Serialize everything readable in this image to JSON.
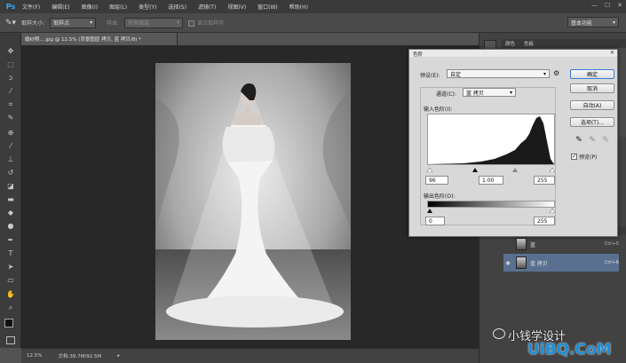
{
  "app": {
    "logo": "Ps"
  },
  "menu": [
    "文件(F)",
    "编辑(E)",
    "图像(I)",
    "图层(L)",
    "类型(Y)",
    "选择(S)",
    "滤镜(T)",
    "视图(V)",
    "窗口(W)",
    "帮助(H)"
  ],
  "window_controls": [
    "—",
    "☐",
    "✕"
  ],
  "options": {
    "sample_size_label": "取样大小:",
    "sample_size_value": "取样点",
    "sample_label": "样本:",
    "sample_value": "所有图层",
    "show_ring_label": "显示取样环",
    "workspace": "基本功能"
  },
  "document": {
    "tab_title": "婚纱照....jpg @ 12.5% (背景图层 拷贝, 蓝 拷贝/8) *",
    "zoom": "12.5%",
    "doc_size": "文档:39.7M/92.5M"
  },
  "panels": {
    "tabs": [
      "颜色",
      "色板"
    ],
    "layers": [
      {
        "name": "蓝",
        "shortcut": "Ctrl+5"
      },
      {
        "name": "蓝 拷贝",
        "shortcut": "Ctrl+6"
      }
    ]
  },
  "watermark": {
    "line1": "小钱学设计",
    "line2": "UiBQ.CoM"
  },
  "levels": {
    "title": "色阶",
    "preset_label": "预设(E):",
    "preset_value": "自定",
    "channel_label": "通道(C):",
    "channel_value": "蓝 拷贝",
    "input_label": "输入色阶(I):",
    "input_black": "96",
    "input_gamma": "1.00",
    "input_white": "255",
    "output_label": "输出色阶(O):",
    "output_black": "0",
    "output_white": "255",
    "buttons": {
      "ok": "确定",
      "cancel": "取消",
      "auto": "自动(A)",
      "options": "选项(T)..."
    },
    "preview_label": "预览(P)",
    "preview_checked": true,
    "close": "✕"
  },
  "tools": [
    "move-icon",
    "marquee-icon",
    "lasso-icon",
    "quick-select-icon",
    "crop-icon",
    "eyedropper-icon",
    "healing-icon",
    "brush-icon",
    "stamp-icon",
    "history-brush-icon",
    "eraser-icon",
    "gradient-icon",
    "blur-icon",
    "dodge-icon",
    "pen-icon",
    "type-icon",
    "path-select-icon",
    "shape-icon",
    "hand-icon",
    "zoom-icon"
  ]
}
